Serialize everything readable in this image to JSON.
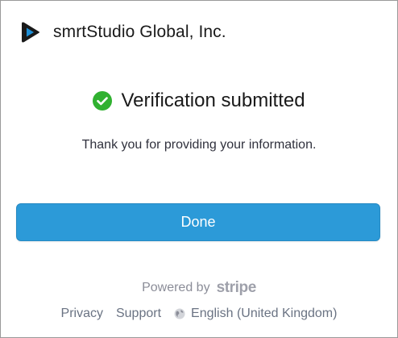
{
  "header": {
    "logo_icon": "smrtstudio-play-logo-icon",
    "company_name": "smrtStudio Global, Inc."
  },
  "status": {
    "icon": "check-circle-icon",
    "title": "Verification submitted",
    "message": "Thank you for providing your information."
  },
  "actions": {
    "done_label": "Done"
  },
  "branding": {
    "powered_by": "Powered by",
    "stripe_wordmark": "stripe"
  },
  "footer": {
    "privacy_label": "Privacy",
    "support_label": "Support",
    "language_icon": "globe-icon",
    "language_label": "English (United Kingdom)"
  },
  "colors": {
    "primary_button": "#2c9ad8",
    "success_green": "#30b130",
    "logo_blue": "#1e8fd6",
    "logo_dark": "#1a1a1a",
    "muted_text": "#8b8d98"
  }
}
